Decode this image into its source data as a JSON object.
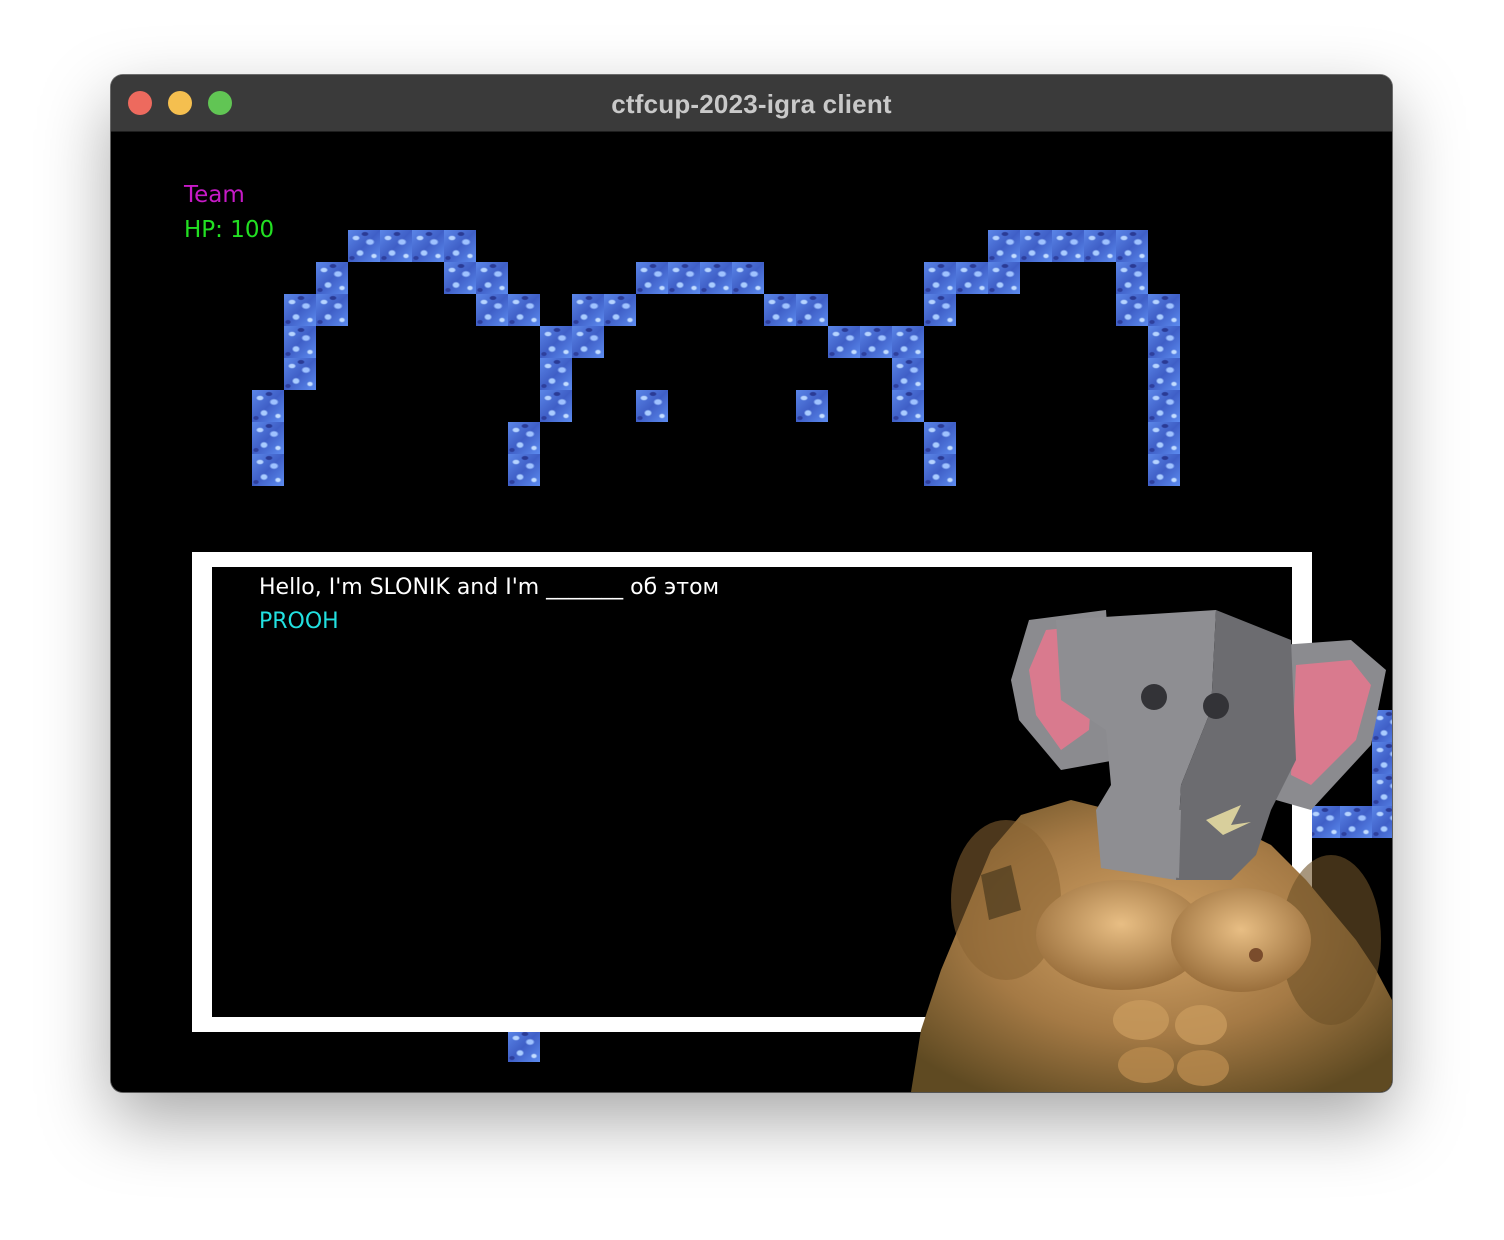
{
  "window": {
    "title": "ctfcup-2023-igra client",
    "controls": [
      "close",
      "minimize",
      "maximize"
    ],
    "colors": {
      "close": "#ed6a5e",
      "minimize": "#f5bf4f",
      "maximize": "#61c554"
    }
  },
  "hud": {
    "team": "Team",
    "hp": "HP: 100",
    "colors": {
      "team": "#c71ac7",
      "hp": "#22e022"
    }
  },
  "dialog": {
    "text": "Hello, I'm SLONIK and I'm _______ об этом",
    "speaker": "PROOH",
    "colors": {
      "text": "#ffffff",
      "speaker": "#22e0e0",
      "border": "#ffffff"
    }
  },
  "portrait": {
    "icon": "elephant-head-muscular-body-icon"
  },
  "tiles": {
    "texture": "blue-stone-tile"
  }
}
